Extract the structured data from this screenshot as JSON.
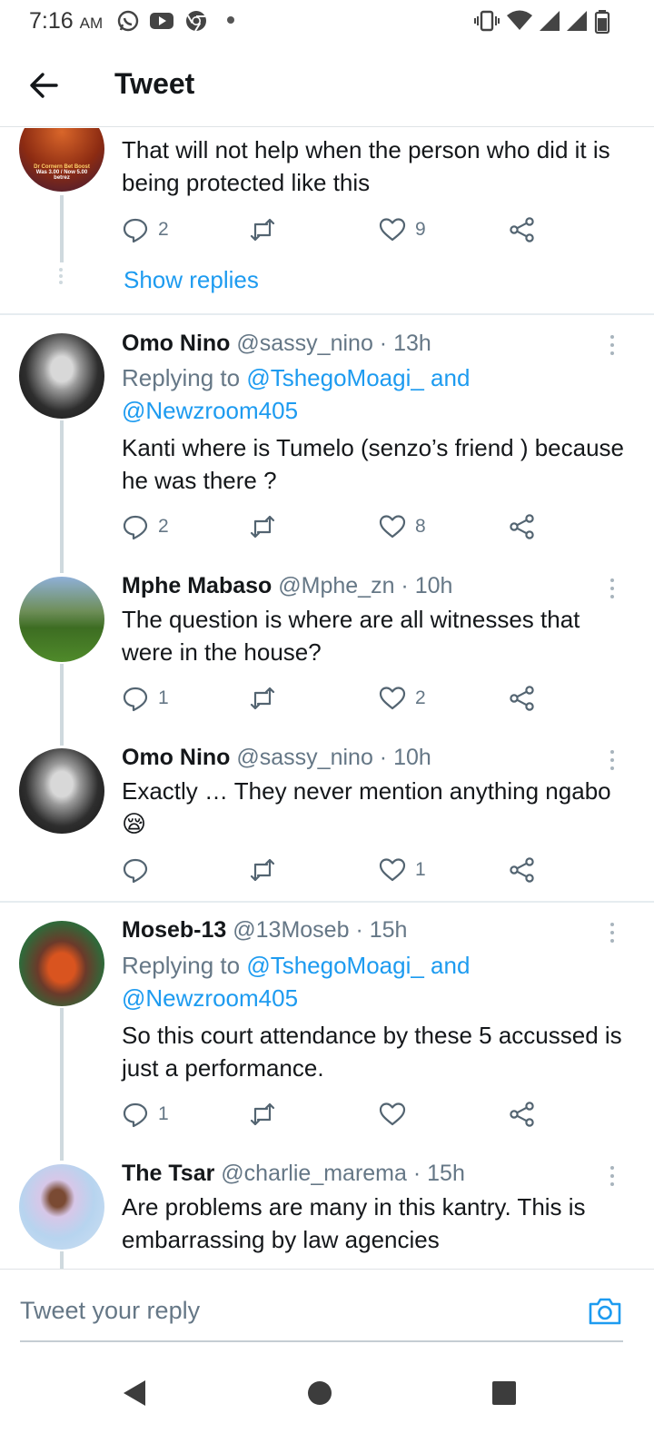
{
  "status_bar": {
    "time": "7:16",
    "ampm": "AM"
  },
  "header": {
    "title": "Tweet"
  },
  "colors": {
    "link": "#1d9bf0",
    "text": "#14171a",
    "muted": "#657786",
    "divider": "#e6ecf0",
    "thread_line": "#cfd9de"
  },
  "top_tweet": {
    "avatar_lines": [
      "Dr Cornern Bet Boost",
      "Was 3.00 / Now 5.00",
      "betrez"
    ],
    "text": "That will not help when the person who did it is being protected like this",
    "replies": "2",
    "likes": "9",
    "show_replies": "Show replies"
  },
  "tweets": [
    {
      "name": "Omo Nino",
      "handle": "@sassy_nino",
      "time": "13h",
      "replying_prefix": "Replying to",
      "replying_to_1": "@TshegoMoagi_ and",
      "replying_to_2": "@Newzroom405",
      "text": "Kanti where is Tumelo (senzo’s friend ) because he was there ?",
      "replies": "2",
      "likes": "8"
    },
    {
      "name": "Mphe Mabaso",
      "handle": "@Mphe_zn",
      "time": "10h",
      "text": "The question is where are all witnesses that were in the house?",
      "replies": "1",
      "likes": "2"
    },
    {
      "name": "Omo Nino",
      "handle": "@sassy_nino",
      "time": "10h",
      "text": "Exactly … They never mention anything ngabo 😪",
      "replies": "",
      "likes": "1"
    },
    {
      "name": "Moseb-13",
      "handle": "@13Moseb",
      "time": "15h",
      "replying_prefix": "Replying to",
      "replying_to_1": "@TshegoMoagi_ and",
      "replying_to_2": "@Newzroom405",
      "text": "So this court attendance by these 5 accussed is just a performance.",
      "replies": "1",
      "likes": ""
    },
    {
      "name": "The Tsar",
      "handle": "@charlie_marema",
      "time": "15h",
      "text": "Are problems are many in this kantry. This is embarrassing by law agencies"
    }
  ],
  "composer": {
    "placeholder": "Tweet your reply"
  },
  "icons": [
    "whatsapp-icon",
    "youtube-icon",
    "chrome-icon",
    "vibrate-icon",
    "wifi-icon",
    "signal-icon",
    "battery-icon",
    "back-arrow-icon",
    "reply-icon",
    "retweet-icon",
    "like-icon",
    "share-icon",
    "more-icon",
    "camera-icon",
    "nav-back-icon",
    "nav-home-icon",
    "nav-recents-icon"
  ]
}
